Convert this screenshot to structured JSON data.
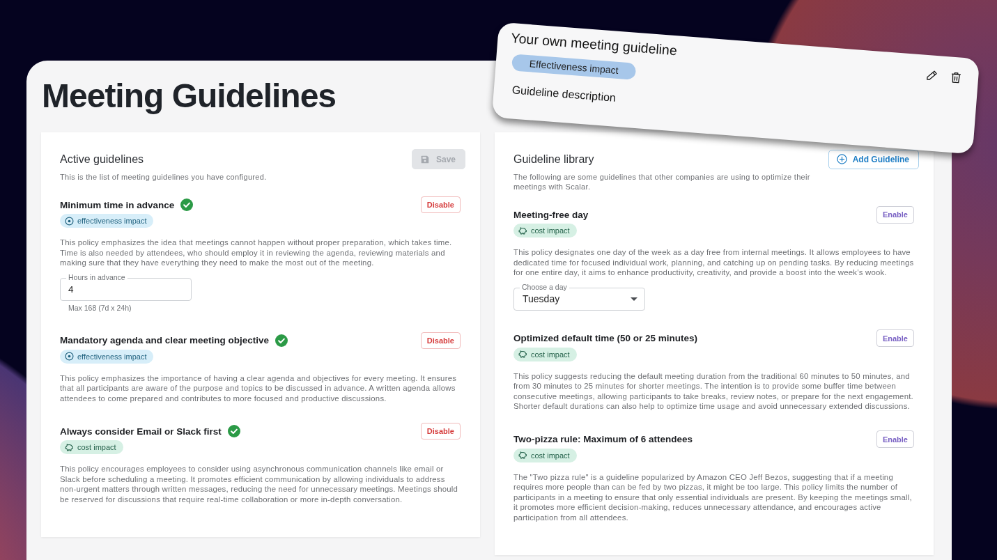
{
  "page_title": "Meeting Guidelines",
  "sections": [
    {
      "title": "Active guidelines",
      "subtitle": "This is the list of meeting guidelines you have configured.",
      "header_button": {
        "kind": "save",
        "label": "Save",
        "disabled": true
      },
      "guidelines": [
        {
          "title": "Minimum time in advance",
          "enabled": true,
          "action": "Disable",
          "tag": {
            "kind": "effectiveness",
            "label": "effectiveness impact"
          },
          "description": "This policy emphasizes the idea that meetings cannot happen without proper preparation, which takes time. Time is also needed by attendees, who should employ it in reviewing the agenda, reviewing materials and making sure that they have everything they need to make the most out of the meeting.",
          "field": {
            "kind": "number",
            "label": "Hours in advance",
            "value": "4",
            "helper": "Max 168 (7d x 24h)"
          }
        },
        {
          "title": "Mandatory agenda and clear meeting objective",
          "enabled": true,
          "action": "Disable",
          "tag": {
            "kind": "effectiveness",
            "label": "effectiveness impact"
          },
          "description": "This policy emphasizes the importance of having a clear agenda and objectives for every meeting. It ensures that all participants are aware of the purpose and topics to be discussed in advance. A written agenda allows attendees to come prepared and contributes to more focused and productive discussions."
        },
        {
          "title": "Always consider Email or Slack first",
          "enabled": true,
          "action": "Disable",
          "tag": {
            "kind": "cost",
            "label": "cost impact"
          },
          "description": "This policy encourages employees to consider using asynchronous communication channels like email or Slack before scheduling a meeting. It promotes efficient communication by allowing individuals to address non-urgent matters through written messages, reducing the need for unnecessary meetings. Meetings should be reserved for discussions that require real-time collaboration or more in-depth conversation."
        }
      ]
    },
    {
      "title": "Guideline library",
      "subtitle": "The following are some guidelines that other companies are using to optimize their meetings with Scalar.",
      "header_button": {
        "kind": "add",
        "label": "Add Guideline",
        "disabled": false
      },
      "guidelines": [
        {
          "title": "Meeting-free day",
          "enabled": false,
          "action": "Enable",
          "tag": {
            "kind": "cost",
            "label": "cost impact"
          },
          "description": "This policy designates one day of the week as a day free from internal meetings. It allows employees to have dedicated time for focused individual work, planning, and catching up on pending tasks. By reducing meetings for one entire day, it aims to enhance productivity, creativity, and provide a boost into the week’s wook.",
          "field": {
            "kind": "select",
            "label": "Choose a day",
            "value": "Tuesday"
          }
        },
        {
          "title": "Optimized default time (50 or 25 minutes)",
          "enabled": false,
          "action": "Enable",
          "tag": {
            "kind": "cost",
            "label": "cost impact"
          },
          "description": "This policy suggests reducing the default meeting duration from the traditional 60 minutes to 50 minutes, and from 30 minutes to 25 minutes for shorter meetings. The intention is to provide some buffer time between consecutive meetings, allowing participants to take breaks, review notes, or prepare for the next engagement. Shorter default durations can also help to optimize time usage and avoid unnecessary extended discussions."
        },
        {
          "title": "Two-pizza rule: Maximum of 6 attendees",
          "enabled": false,
          "action": "Enable",
          "tag": {
            "kind": "cost",
            "label": "cost impact"
          },
          "description": "The \"Two pizza rule\" is a guideline popularized by Amazon CEO Jeff Bezos, suggesting that if a meeting requires more people than can be fed by two pizzas, it might be too large. This policy limits the number of participants in a meeting to ensure that only essential individuals are present. By keeping the meetings small, it promotes more efficient decision-making, reduces unnecessary attendance, and encourages active participation from all attendees."
        }
      ]
    }
  ],
  "custom_guideline": {
    "title": "Your own meeting guideline",
    "tag": "Effectiveness impact",
    "description": "Guideline description"
  }
}
